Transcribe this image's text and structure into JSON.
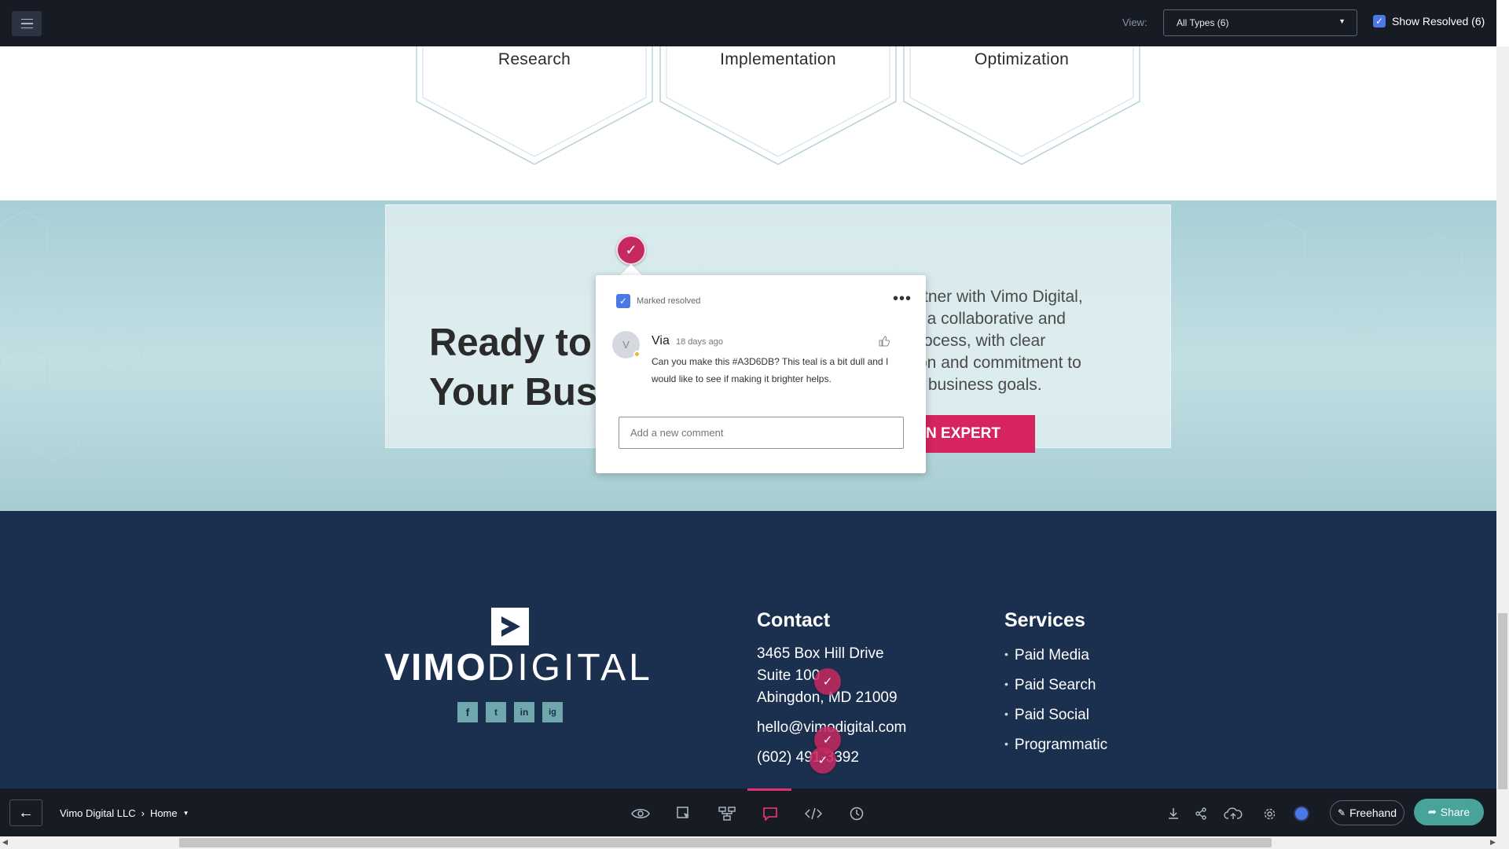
{
  "toolbar": {
    "view_label": "View:",
    "view_select_value": "All Types (6)",
    "show_resolved_label": "Show Resolved (6)"
  },
  "steps": [
    {
      "label": "Research"
    },
    {
      "label": "Implementation"
    },
    {
      "label": "Optimization"
    }
  ],
  "cta": {
    "heading_line1": "Ready to",
    "heading_line2": "Your Bus",
    "body_lines": [
      "rtner with Vimo Digital,",
      "t a collaborative and",
      "rocess, with clear",
      "on and commitment to",
      "r business goals."
    ],
    "button_label": "AN EXPERT"
  },
  "comment_popup": {
    "resolved_label": "Marked resolved",
    "author": "Via",
    "author_initial": "V",
    "time": "18 days ago",
    "text": "Can you make this #A3D6DB? This teal is a bit dull and I would like to see if making it brighter helps.",
    "input_placeholder": "Add a new comment"
  },
  "footer": {
    "logo_bold": "VIMO",
    "logo_light": "DIGITAL",
    "social": [
      "f",
      "t",
      "in",
      "ig"
    ],
    "contact_title": "Contact",
    "address_line1": "3465 Box Hill Drive",
    "address_line2": "Suite 100",
    "address_line3": "Abingdon, MD 21009",
    "email": "hello@vimodigital.com",
    "phone": "(602) 491-3392",
    "services_title": "Services",
    "services": [
      "Paid Media",
      "Paid Search",
      "Paid Social",
      "Programmatic"
    ]
  },
  "bottombar": {
    "client": "Vimo Digital LLC",
    "page": "Home",
    "freehand_label": "Freehand",
    "share_label": "Share"
  },
  "colors": {
    "accent": "#d6245f",
    "pin": "#c42a5f",
    "teal": "#a8cfd6",
    "footer_bg": "#1b2f4f",
    "share_btn": "#48a49a"
  }
}
